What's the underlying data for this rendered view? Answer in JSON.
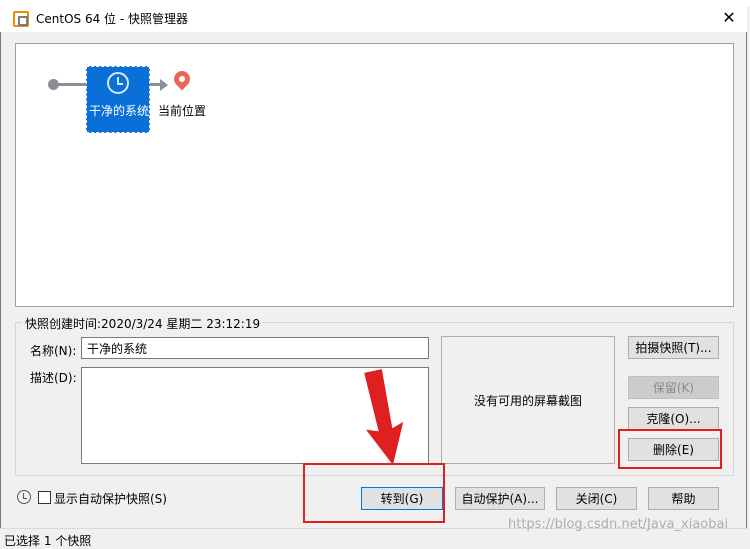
{
  "window": {
    "title": "CentOS 64 位 - 快照管理器",
    "close_glyph": "✕"
  },
  "tree": {
    "snapshot_label": "干净的系统",
    "current_label": "当前位置"
  },
  "details": {
    "created_label": "快照创建时间:",
    "created_value": "2020/3/24 星期二 23:12:19",
    "name_label": "名称(N):",
    "name_value": "干净的系统",
    "desc_label": "描述(D):",
    "desc_value": "",
    "preview_text": "没有可用的屏幕截图"
  },
  "buttons": {
    "take_snapshot": "拍摄快照(T)...",
    "keep": "保留(K)",
    "clone": "克隆(O)...",
    "delete": "删除(E)",
    "goto": "转到(G)",
    "autoprotect": "自动保护(A)...",
    "close": "关闭(C)",
    "help": "帮助"
  },
  "bottom": {
    "show_autoprotect_label": "显示自动保护快照(S)",
    "show_autoprotect_checked": false,
    "status_text": "已选择 1 个快照"
  },
  "icons": {
    "app": "vmware-icon",
    "snapshot": "clock-icon",
    "current": "location-pin-icon",
    "history": "history-icon"
  },
  "colors": {
    "selection": "#0a6fd6",
    "annotation": "#e02020",
    "pin": "#e8675a"
  },
  "watermark": "https://blog.csdn.net/Java_xiaobai"
}
